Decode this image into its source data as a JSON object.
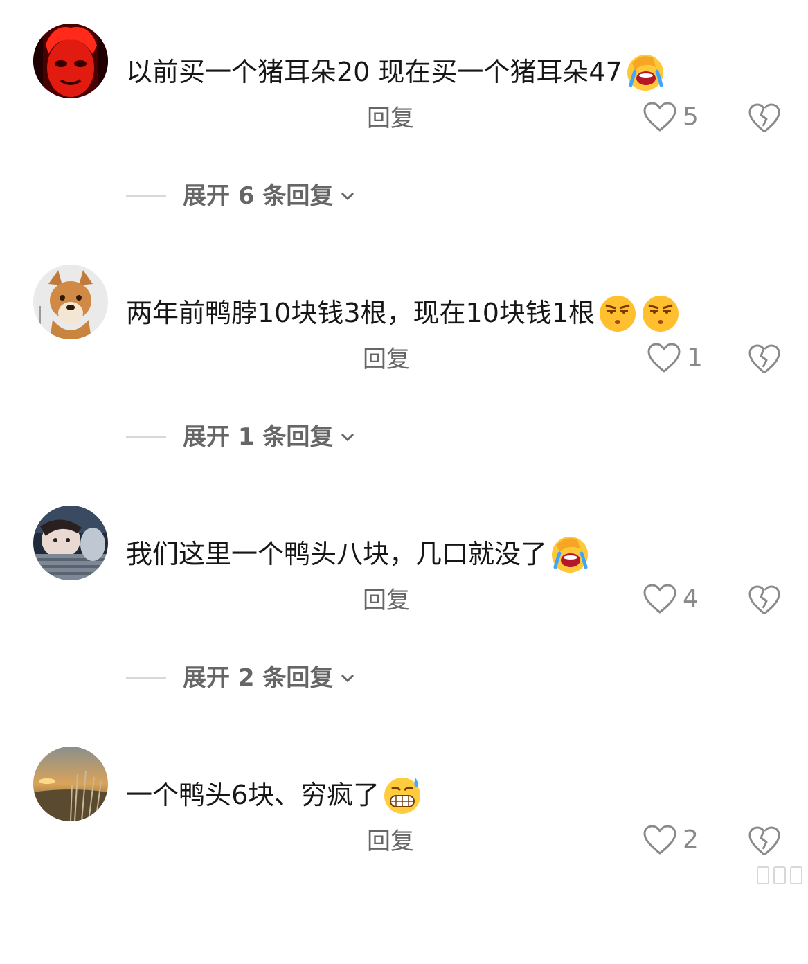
{
  "comments": [
    {
      "avatar": "red-face-avatar",
      "text": "以前买一个猪耳朵20  现在买一个猪耳朵47",
      "emojis": [
        "face-palm-crying-emoji"
      ],
      "reply_label": "回复",
      "likes": "5",
      "expand_label": "展开 6 条回复"
    },
    {
      "avatar": "dog-avatar",
      "text": "两年前鸭脖10块钱3根，现在10块钱1根",
      "emojis": [
        "unamused-face-emoji",
        "unamused-face-emoji"
      ],
      "reply_label": "回复",
      "likes": "1",
      "expand_label": "展开 1 条回复"
    },
    {
      "avatar": "girl-avatar",
      "text": "我们这里一个鸭头八块，几口就没了",
      "emojis": [
        "face-palm-crying-emoji"
      ],
      "reply_label": "回复",
      "likes": "4",
      "expand_label": "展开 2 条回复"
    },
    {
      "avatar": "sunset-avatar",
      "text": "一个鸭头6块、穷疯了",
      "emojis": [
        "grinning-sweat-emoji"
      ],
      "reply_label": "回复",
      "likes": "2"
    }
  ],
  "colors": {
    "text": "#161616",
    "secondary": "#666666",
    "icon": "#8a8a8a",
    "divider": "#d8d8d8"
  }
}
